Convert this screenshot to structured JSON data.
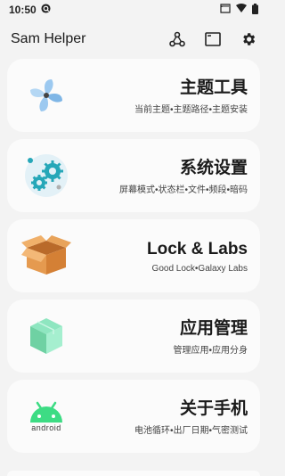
{
  "status_bar": {
    "time": "10:50"
  },
  "app_bar": {
    "title": "Sam Helper"
  },
  "cards": [
    {
      "title": "主题工具",
      "subtitle": "当前主题•主题路径•主题安装",
      "icon": "pinwheel-icon"
    },
    {
      "title": "系统设置",
      "subtitle": "屏幕模式•状态栏•文件•频段•暗码",
      "icon": "gears-icon"
    },
    {
      "title": "Lock & Labs",
      "subtitle": "Good Lock•Galaxy Labs",
      "icon": "box-icon"
    },
    {
      "title": "应用管理",
      "subtitle": "管理应用•应用分身",
      "icon": "cube-icon"
    },
    {
      "title": "关于手机",
      "subtitle": "电池循环•出厂日期•气密测试",
      "icon": "android-icon",
      "icon_label": "android"
    }
  ]
}
